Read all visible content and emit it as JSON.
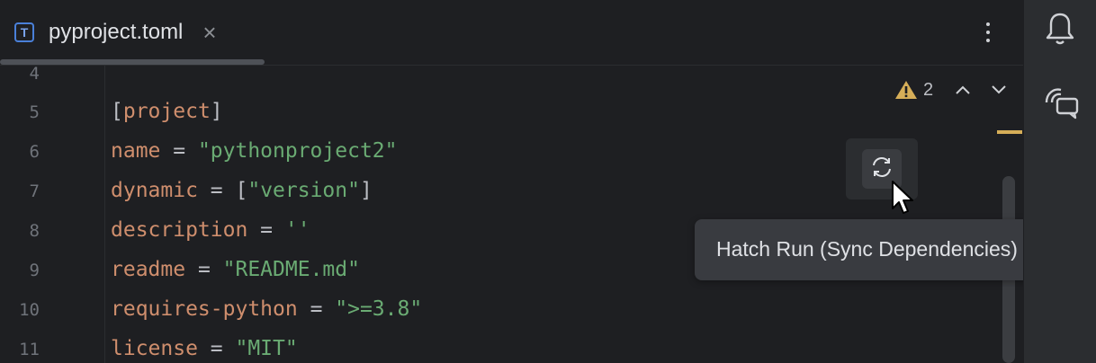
{
  "tab": {
    "icon_letter": "T",
    "title": "pyproject.toml",
    "close_glyph": "×"
  },
  "gutter": {
    "line_numbers": [
      "4",
      "5",
      "6",
      "7",
      "8",
      "9",
      "10",
      "11"
    ]
  },
  "code": {
    "l5": {
      "open": "[",
      "section": "project",
      "close": "]"
    },
    "l6": {
      "key": "name",
      "eq": " = ",
      "value": "\"pythonproject2\""
    },
    "l7": {
      "key": "dynamic",
      "eq": " = ",
      "open": "[",
      "value": "\"version\"",
      "close": "]"
    },
    "l8": {
      "key": "description",
      "eq": " = ",
      "value": "''"
    },
    "l9": {
      "key": "readme",
      "eq": " = ",
      "value": "\"README.md\""
    },
    "l10": {
      "key": "requires-python",
      "eq": " = ",
      "value": "\">=3.8\""
    },
    "l11": {
      "key": "license",
      "eq": " = ",
      "value": "\"MIT\""
    }
  },
  "inspections": {
    "warning_count": "2"
  },
  "tooltip": {
    "text": "Hatch Run (Sync Dependencies)"
  },
  "icons": {
    "file": "toml-file-icon",
    "more": "more-vertical-icon",
    "warning": "warning-icon",
    "up": "chevron-up-icon",
    "down": "chevron-down-icon",
    "sync": "sync-icon",
    "bell": "bell-icon",
    "ai_chat": "ai-chat-icon",
    "cursor": "mouse-pointer-icon"
  },
  "colors": {
    "background": "#1e1f22",
    "keyword": "#cf8e6d",
    "string": "#6aab73",
    "text": "#bcbec4",
    "line_number": "#6f737a",
    "warning": "#d6ae58",
    "tooltip_bg": "#393b40"
  }
}
